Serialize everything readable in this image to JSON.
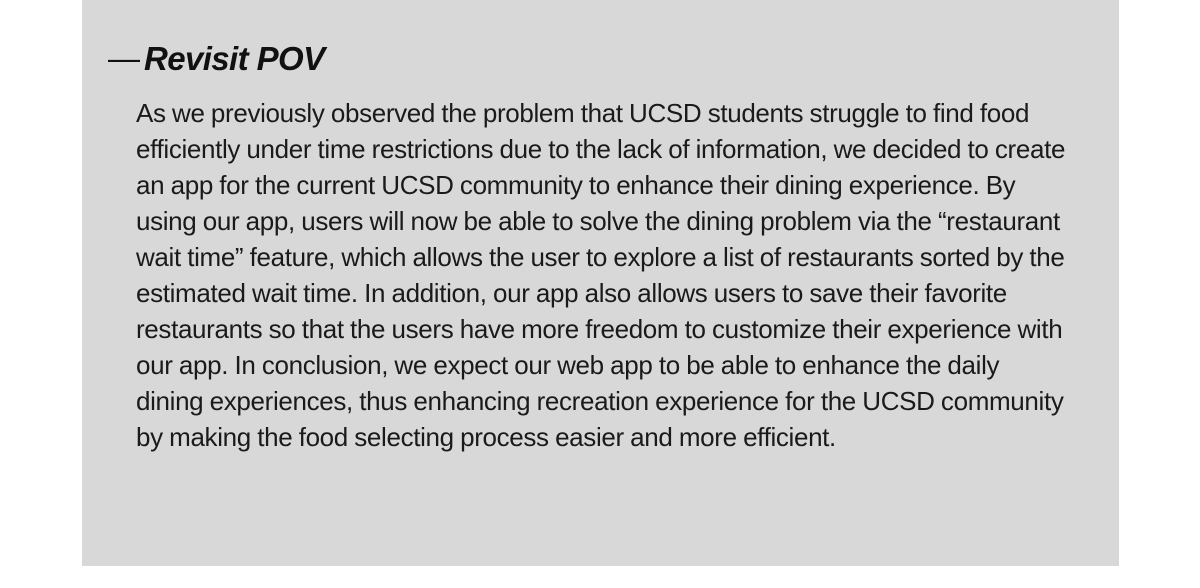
{
  "section": {
    "dash": "—",
    "title": "Revisit POV",
    "body": "As we previously observed the problem that UCSD students struggle to find food efficiently under time restrictions due to the lack of information, we decided to create an app for the current UCSD community to enhance their dining experience. By using our app, users will now be able to solve the dining problem via the “restaurant wait time” feature, which allows the user to explore a list of restaurants sorted by the estimated wait time. In addition, our app also allows users to save their favorite restaurants so that the users have more freedom to customize their experience with our app. In conclusion, we expect our web app to be able to enhance the daily dining experiences, thus enhancing recreation experience for the UCSD community by making the food selecting process easier and more efficient."
  },
  "colors": {
    "panel_background": "#d8d8d8",
    "text": "#1a1a1a"
  }
}
